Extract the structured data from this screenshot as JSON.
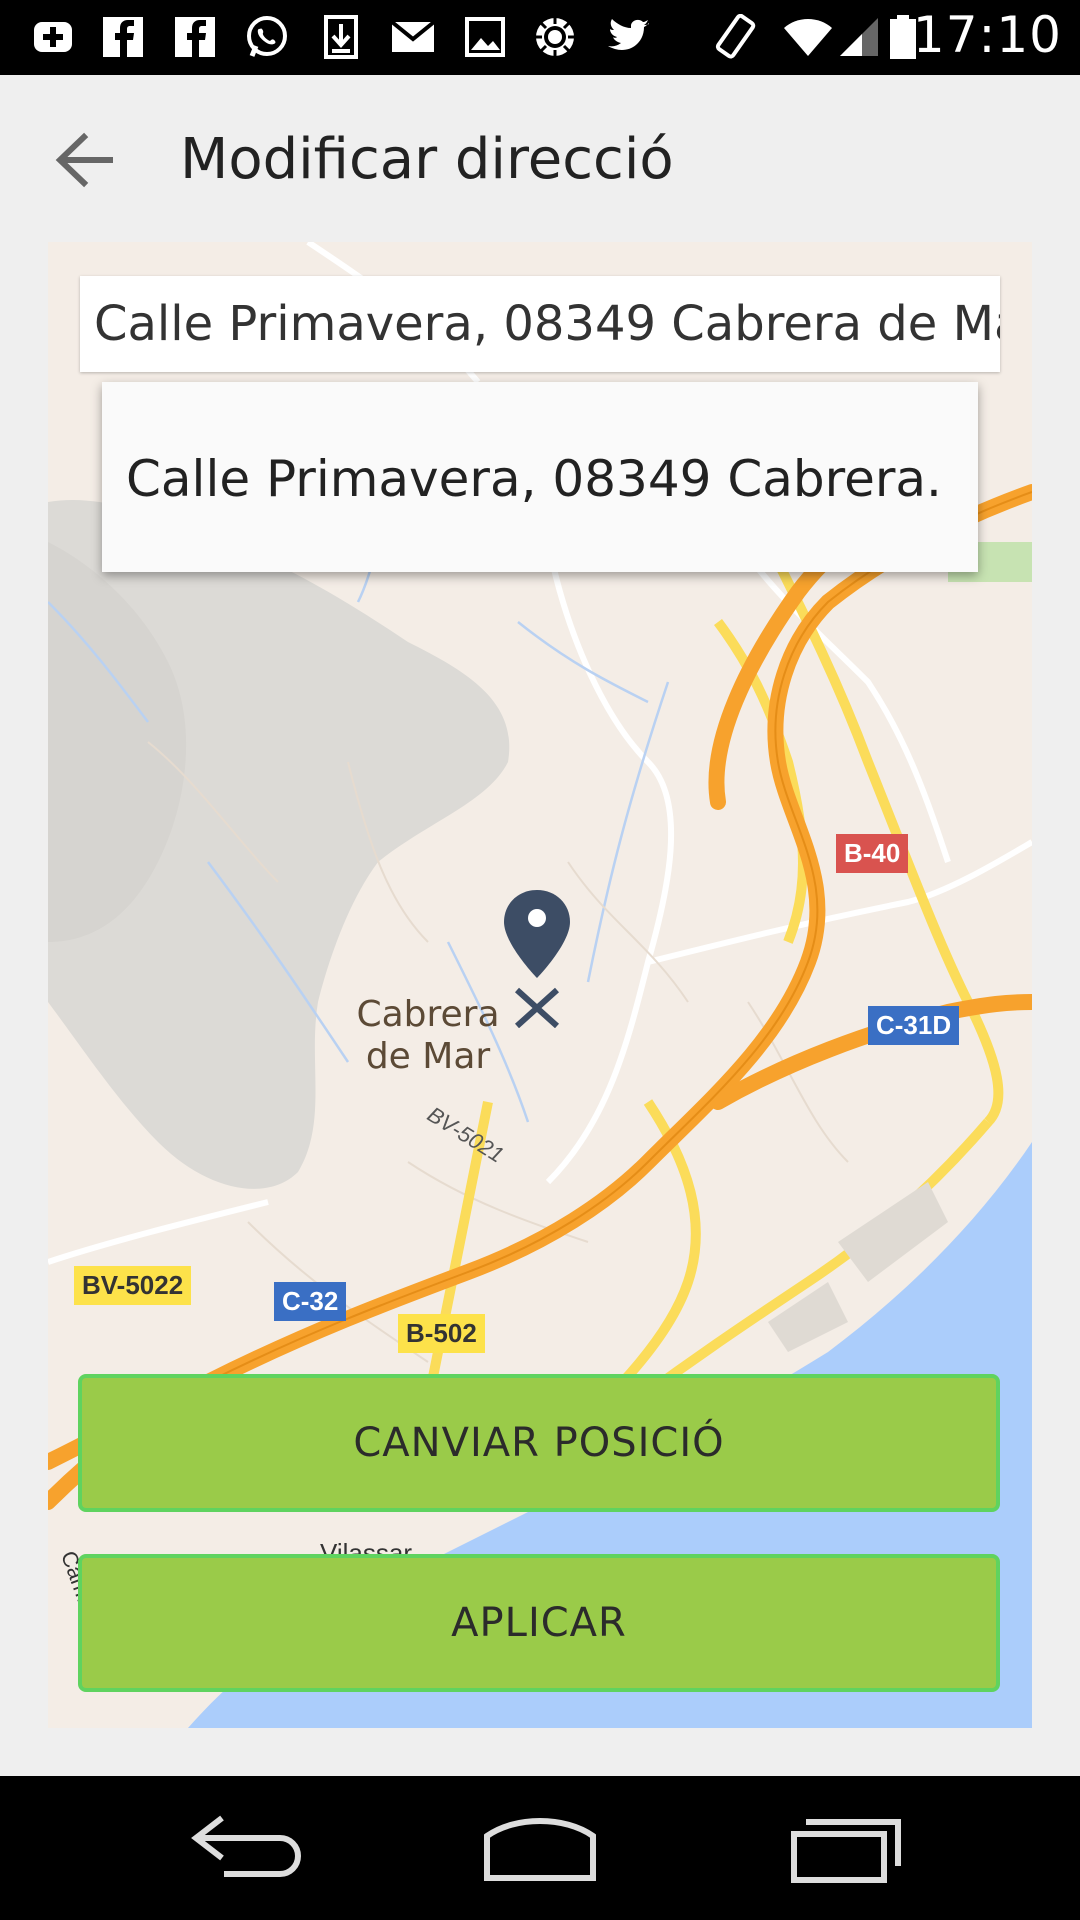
{
  "status_bar": {
    "time": "17:10",
    "icons": [
      "add-notification-icon",
      "facebook-icon",
      "facebook-icon",
      "whatsapp-icon",
      "download-icon",
      "mail-icon",
      "image-icon",
      "settings-ring-icon",
      "twitter-icon",
      "screen-rotation-icon",
      "wifi-icon",
      "signal-icon",
      "battery-icon"
    ]
  },
  "app_bar": {
    "title": "Modificar direcció",
    "back_icon": "arrow-back-icon"
  },
  "map": {
    "search": {
      "value": "Calle Primavera, 08349 Cabrera de Ma"
    },
    "suggestion": "Calle Primavera, 08349 Cabrera.",
    "town_line1": "Cabrera",
    "town_line2": "de Mar",
    "street_label": "BV-5021",
    "road_labels": {
      "bv5022": "BV-5022",
      "c32": "C-32",
      "b502": "B-502",
      "b40": "B-40",
      "c31d": "C-31D"
    },
    "partial_labels": {
      "vilassar": "Vilassar",
      "cami": "Camí de"
    },
    "colors": {
      "land": "#f4ede6",
      "highway": "#f7a22d",
      "main_road": "#fbdc5a",
      "water": "#abcdfb",
      "park": "#dcdad6"
    }
  },
  "buttons": {
    "change_position": "CANVIAR POSICIÓ",
    "apply": "APLICAR"
  },
  "nav_bar": {
    "back": "nav-back-icon",
    "home": "nav-home-icon",
    "recents": "nav-recents-icon"
  }
}
